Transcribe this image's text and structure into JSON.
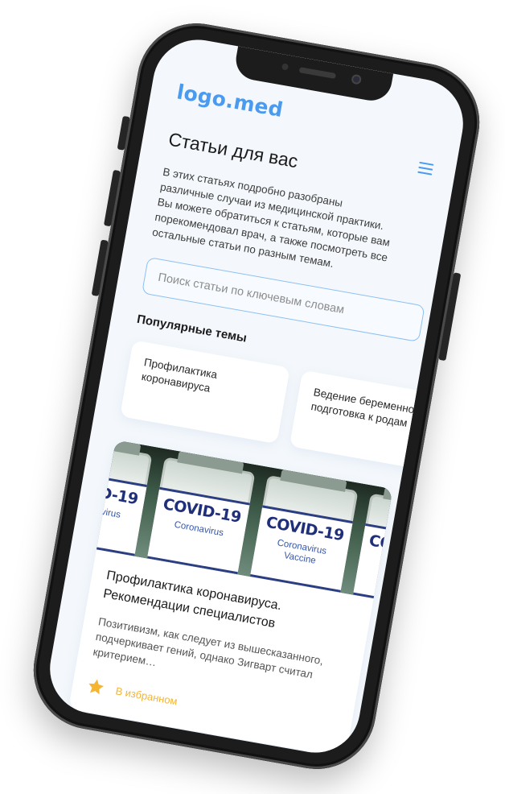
{
  "app": {
    "logo": "logo.med"
  },
  "page": {
    "title": "Статьи для вас",
    "intro": "В этих статьях подробно разобраны различные случаи из медицинской практики. Вы можете обратиться к статьям, которые вам порекомендовал врач, а также посмотреть все остальные статьи по разным темам."
  },
  "search": {
    "value": "",
    "placeholder": "Поиск статьи по ключевым словам"
  },
  "topics": {
    "heading": "Популярные темы",
    "items": [
      {
        "label": "Профилактика коронавируса"
      },
      {
        "label": "Ведение беременности и подготовка к родам"
      }
    ]
  },
  "article": {
    "image": {
      "vial_brand": "COVID-19",
      "vial_sub": "Coronavirus",
      "vial_sub2": "Vaccine"
    },
    "title": "Профилактика коронавируса. Рекомендации специалистов",
    "excerpt": "Позитивизм, как следует из вышесказанного, подчеркивает гений, однако Зигварт считал критерием…",
    "favorite_label": "В избранном",
    "favorite_icon": "star-icon"
  },
  "colors": {
    "accent": "#4a9bef",
    "favorite": "#f5b530"
  }
}
